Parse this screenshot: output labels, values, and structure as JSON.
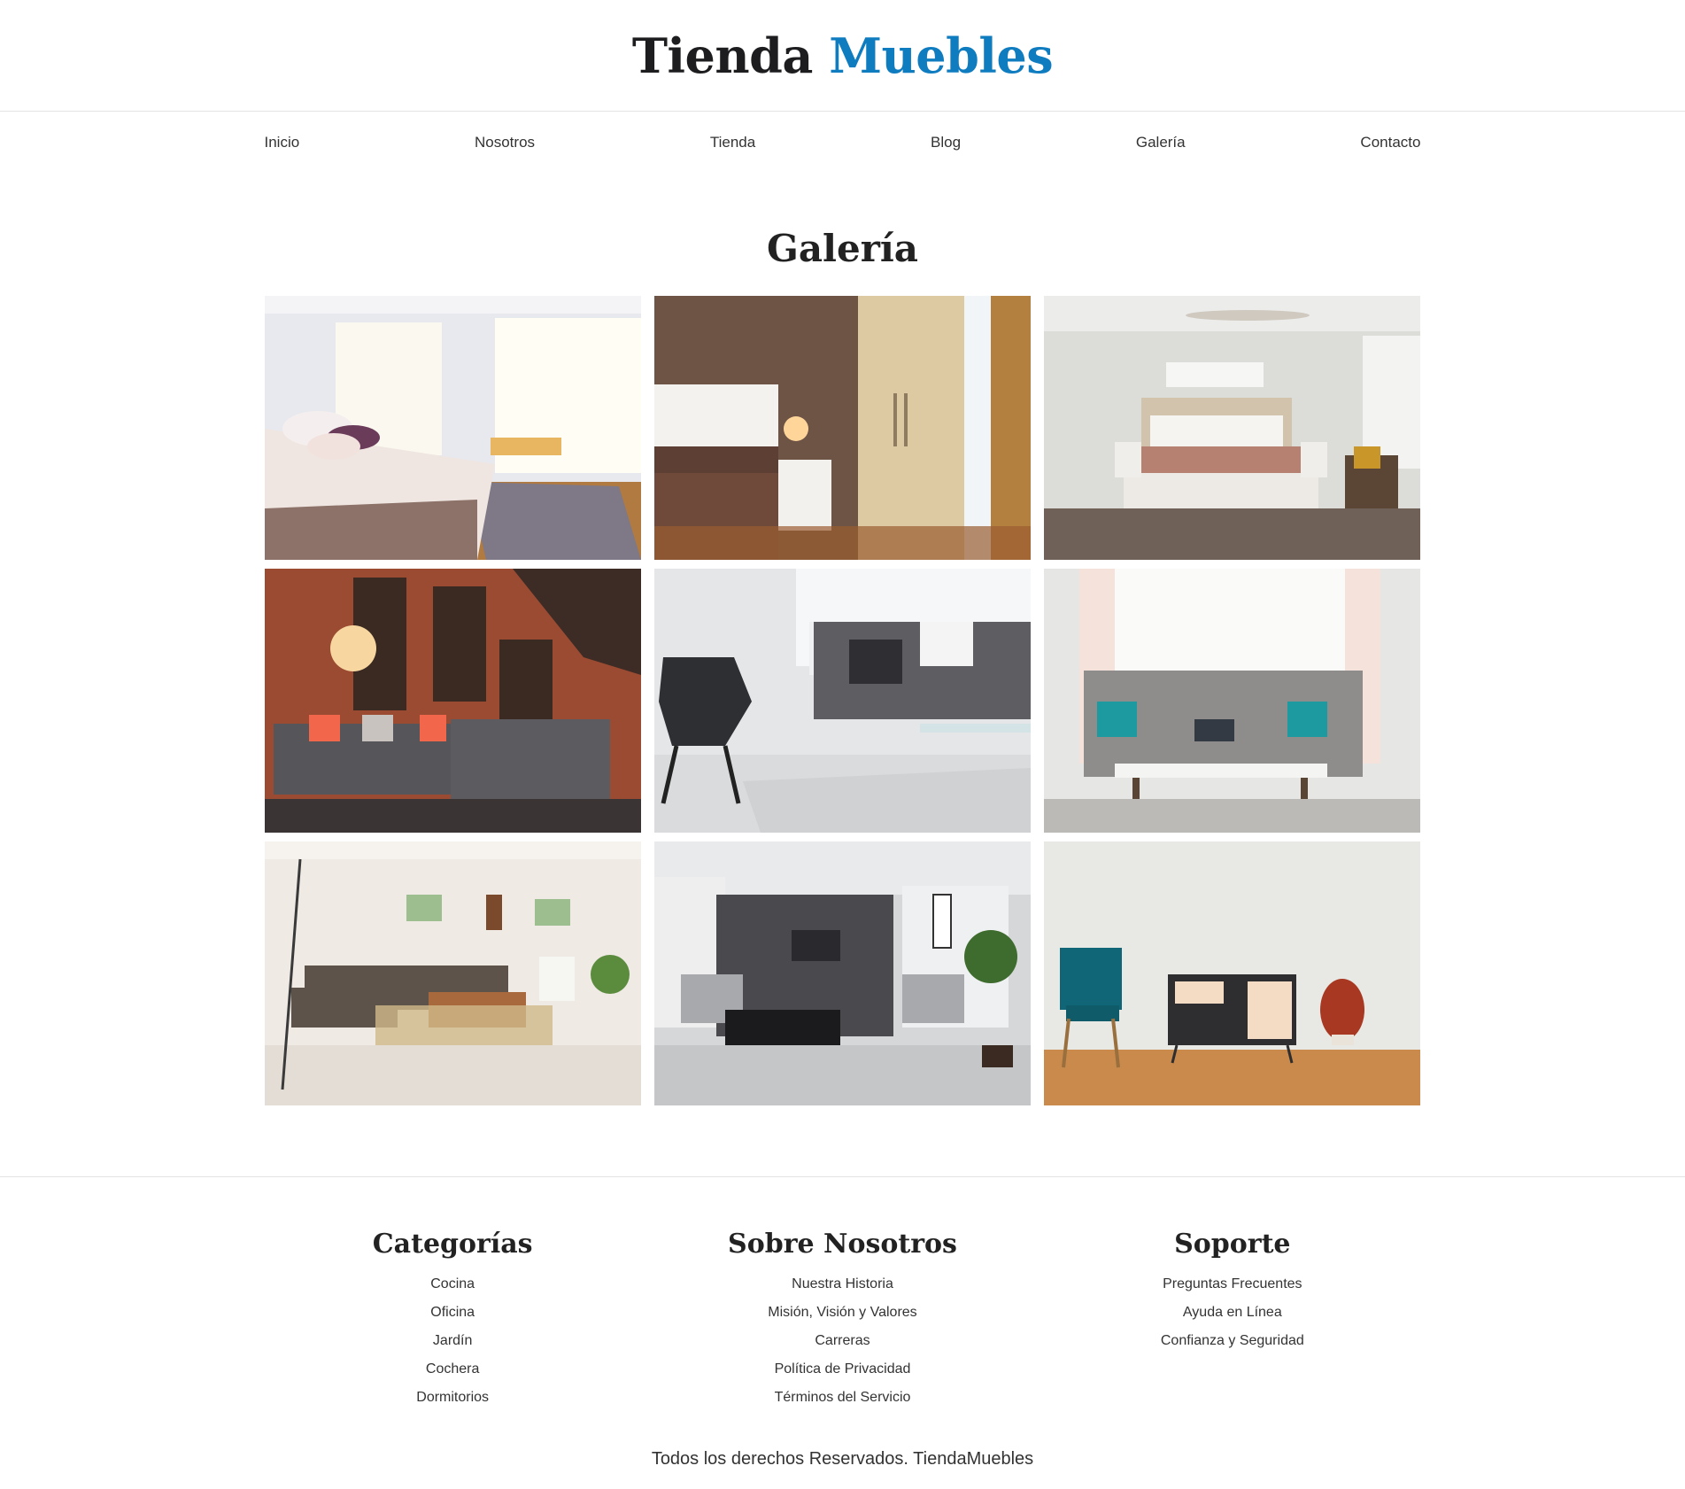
{
  "brand": {
    "part1": "Tienda",
    "part2": "Muebles",
    "accent_color": "#0f7cc0"
  },
  "nav": [
    "Inicio",
    "Nosotros",
    "Tienda",
    "Blog",
    "Galería",
    "Contacto"
  ],
  "gallery": {
    "title": "Galería",
    "images": [
      "bedroom-bright-curtains-photo",
      "bedroom-wardrobe-lamp-photo",
      "bedroom-ceiling-fan-photo",
      "livingroom-brick-bookshelves-photo",
      "livingroom-grey-sofa-black-chair-photo",
      "livingroom-tufted-sofa-teal-pillows-photo",
      "livingroom-white-brick-sectional-photo",
      "livingroom-modern-tv-wall-photo",
      "teal-chair-sideboard-vase-photo"
    ]
  },
  "footer": {
    "columns": [
      {
        "title": "Categorías",
        "links": [
          "Cocina",
          "Oficina",
          "Jardín",
          "Cochera",
          "Dormitorios"
        ]
      },
      {
        "title": "Sobre Nosotros",
        "links": [
          "Nuestra Historia",
          "Misión, Visión y Valores",
          "Carreras",
          "Política de Privacidad",
          "Términos del Servicio"
        ]
      },
      {
        "title": "Soporte",
        "links": [
          "Preguntas Frecuentes",
          "Ayuda en Línea",
          "Confianza y Seguridad"
        ]
      }
    ],
    "copyright": "Todos los derechos Reservados. TiendaMuebles"
  }
}
